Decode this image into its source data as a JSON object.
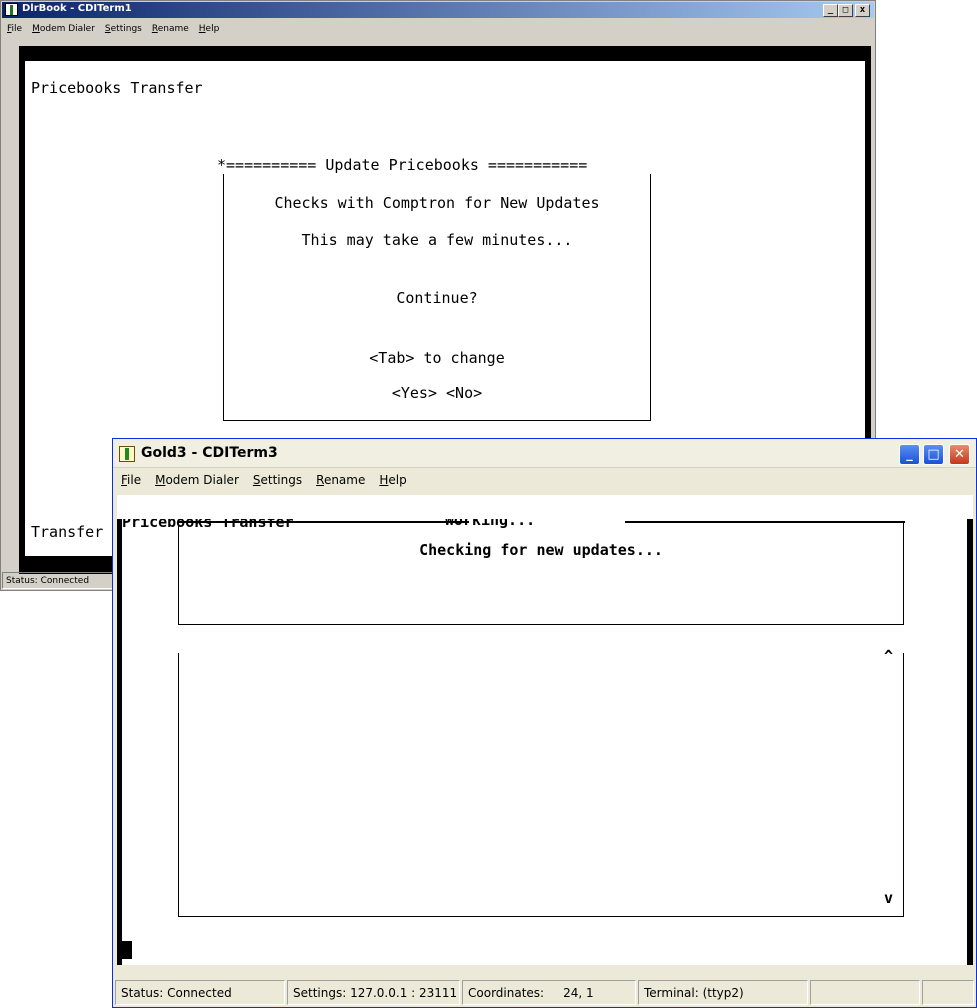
{
  "back_window": {
    "title": "DlrBook - CDITerm1",
    "controls": {
      "minimize": "_",
      "maximize": "□",
      "close": "x"
    },
    "menu": [
      "File",
      "Modem Dialer",
      "Settings",
      "Rename",
      "Help"
    ],
    "terminal": {
      "heading": "Pricebooks Transfer",
      "footer_text": "Transfer",
      "dialog": {
        "header": "*========== Update Pricebooks ===========",
        "line1": "Checks with Comptron for New Updates",
        "line2": "This may take a few minutes...",
        "line3": "Continue?",
        "line4": "<Tab> to change",
        "yes": "<Yes>",
        "no": "<No>"
      }
    },
    "status": "Status: Connected"
  },
  "front_window": {
    "title": "Gold3 - CDITerm3",
    "controls": {
      "minimize": "_",
      "maximize": "□",
      "close": "✕"
    },
    "menu": [
      "File",
      "Modem Dialer",
      "Settings",
      "Rename",
      "Help"
    ],
    "terminal": {
      "heading": "Pricebooks Transfer",
      "working_title": "Working...",
      "working_msg": "Checking for new updates...",
      "scroll_up": "^",
      "scroll_down": "v"
    },
    "statusbar": {
      "status": "Status:  Connected",
      "settings": "Settings: 127.0.0.1 : 23111",
      "coordinates_label": "Coordinates:",
      "coordinates_value": "24, 1",
      "terminal": "Terminal: (ttyp2)"
    }
  }
}
